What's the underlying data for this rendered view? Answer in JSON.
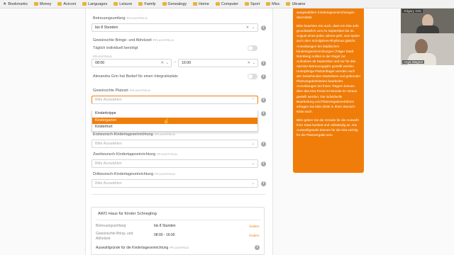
{
  "bookmarks_bar": {
    "items": [
      {
        "label": "Bookmarks",
        "icon": "star-icon"
      },
      {
        "label": "Money",
        "icon": "folder-icon"
      },
      {
        "label": "Aviconi",
        "icon": "folder-icon"
      },
      {
        "label": "Languages",
        "icon": "folder-icon"
      },
      {
        "label": "Leisure",
        "icon": "folder-icon"
      },
      {
        "label": "Family",
        "icon": "folder-icon"
      },
      {
        "label": "Genealogy",
        "icon": "folder-icon"
      },
      {
        "label": "Home",
        "icon": "folder-icon"
      },
      {
        "label": "Computer",
        "icon": "folder-icon"
      },
      {
        "label": "Sport",
        "icon": "folder-icon"
      },
      {
        "label": "Misc",
        "icon": "folder-icon"
      },
      {
        "label": "Ukraine",
        "icon": "folder-icon"
      }
    ]
  },
  "form": {
    "care_scope": {
      "label": "Betreuungsumfang",
      "required": "PFLICHTFELD",
      "value": "bis 8 Stunden"
    },
    "pickup_time": {
      "label": "Gewünschte Bringe- und Abholzeit",
      "required": "PFLICHTFELD",
      "daily_label": "Täglich individuell benötigt",
      "from_label": "PFLICHTFELD",
      "from": "08:00",
      "separator": "-",
      "to": "16:00"
    },
    "integration": {
      "label": "Alexandra Grin hat Bedarf für einen Integrativplatz"
    },
    "place": {
      "label": "Gewünschte Platzart",
      "required": "PFLICHTFELD",
      "placeholder": "Bitte Auswählen",
      "options": [
        "Kinderkrippe",
        "Kindergarten",
        "Kinderhort"
      ],
      "highlighted": "Kindergarten"
    },
    "first_choice": {
      "label": "Erstwunsch-Kindertageseinrichtung",
      "required": "PFLICHTFELD",
      "placeholder": "Bitte Auswählen"
    },
    "second_choice": {
      "label": "Zweitwunsch-Kindertageseinrichtung",
      "required": "PFLICHTFELD",
      "placeholder": "Bitte Auswählen"
    },
    "third_choice": {
      "label": "Drittwunsch-Kindertageseinrichtung",
      "required": "PFLICHTFELD",
      "placeholder": "Bitte Auswählen"
    }
  },
  "summary": {
    "title": "AWO Haus für Kinder Schnegling",
    "rows": [
      {
        "label": "Betreuungsumfang",
        "value": "bis 8 Stunden",
        "action": "Ändern"
      },
      {
        "label": "Gewünschte Bring- und Abholzeit",
        "value": "08:00 - 16:00",
        "action": "Ändern"
      },
      {
        "label": "Auswahlgründe für die Kindertageseinrichtung",
        "required": "PFLICHTFELD"
      }
    ]
  },
  "info_panel": {
    "paragraphs": [
      "ausgewählten Kindertageseinrichtungen übermittelt.",
      "Bitte beachten Sie auch, dass ein Kita-Jahr grundsätzlich vom 01 September bis 31. August eines jeden Jahres geht, was später auch dem Schuljahres-Rhythmus gleicht. Anmeldungen bei städtischen Kindertageseinrichtungen (Träger Stadt Nürnberg) sollten in der Regel zur Aufnahme ab September und nur für das nächste Betreuungsjahr gestellt werden. Unterjährige Platzanfragen werden nach den bestehenden Wartelisten und geltenden Platzvergabekriterien bearbeitet. Anmeldungen bei freien Trägern können über das Kita-Portal 24 Monate im Voraus gestellt werden. Die individuelle Bearbeitung und Platzvergabeverfahren erfragen Sie bitte direkt in Ihren Wunsch-Kitas nach.",
      "Bitte geben Sie die Gründe für die Auswahl Ihrer Kitas konkret und vollständig an. Die Auswahlgründe können für die Kita wichtig für die Platzvergabe sein."
    ],
    "background": "#f07d0a"
  },
  "video_call": {
    "participants": [
      {
        "name": "Grigory Grin"
      },
      {
        "name": "Asya Wagner"
      }
    ]
  }
}
